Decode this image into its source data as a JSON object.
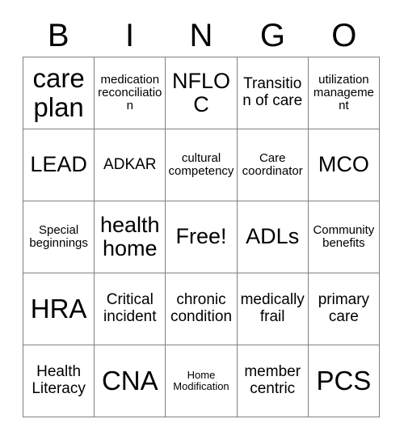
{
  "header": {
    "letters": [
      "B",
      "I",
      "N",
      "G",
      "O"
    ]
  },
  "grid": {
    "rows": [
      [
        {
          "label": "care plan",
          "size": "size-xl"
        },
        {
          "label": "medication reconciliation",
          "size": "size-sm"
        },
        {
          "label": "NFLOC",
          "size": "size-lg"
        },
        {
          "label": "Transition of care",
          "size": "size-md"
        },
        {
          "label": "utilization management",
          "size": "size-sm"
        }
      ],
      [
        {
          "label": "LEAD",
          "size": "size-lg"
        },
        {
          "label": "ADKAR",
          "size": "size-md"
        },
        {
          "label": "cultural competency",
          "size": "size-sm"
        },
        {
          "label": "Care coordinator",
          "size": "size-sm"
        },
        {
          "label": "MCO",
          "size": "size-lg"
        }
      ],
      [
        {
          "label": "Special beginnings",
          "size": "size-sm"
        },
        {
          "label": "health home",
          "size": "size-lg"
        },
        {
          "label": "Free!",
          "size": "size-lg"
        },
        {
          "label": "ADLs",
          "size": "size-lg"
        },
        {
          "label": "Community benefits",
          "size": "size-sm"
        }
      ],
      [
        {
          "label": "HRA",
          "size": "size-xl"
        },
        {
          "label": "Critical incident",
          "size": "size-md"
        },
        {
          "label": "chronic condition",
          "size": "size-md"
        },
        {
          "label": "medically frail",
          "size": "size-md"
        },
        {
          "label": "primary care",
          "size": "size-md"
        }
      ],
      [
        {
          "label": "Health Literacy",
          "size": "size-md"
        },
        {
          "label": "CNA",
          "size": "size-xl"
        },
        {
          "label": "Home Modification",
          "size": "size-xs"
        },
        {
          "label": "member centric",
          "size": "size-md"
        },
        {
          "label": "PCS",
          "size": "size-xl"
        }
      ]
    ]
  }
}
